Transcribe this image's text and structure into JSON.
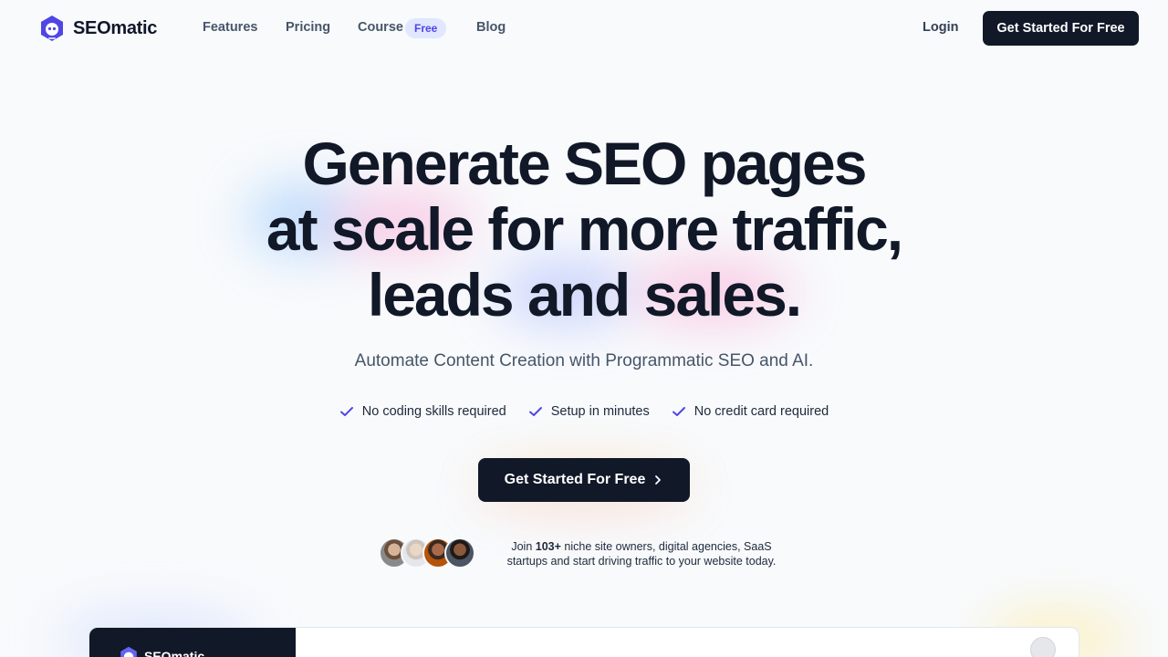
{
  "brand": {
    "name": "SEOmatic",
    "accent": "#4f46e5",
    "dark": "#111827"
  },
  "nav": {
    "features": "Features",
    "pricing": "Pricing",
    "course": "Course",
    "course_badge": "Free",
    "blog": "Blog",
    "login": "Login",
    "cta": "Get Started For Free"
  },
  "hero": {
    "line1": "Generate SEO pages",
    "line2": "at scale for more traffic,",
    "line3": "leads and sales.",
    "subtitle": "Automate Content Creation with Programmatic SEO and AI.",
    "checks": [
      "No coding skills required",
      "Setup in minutes",
      "No credit card required"
    ],
    "cta": "Get Started For Free",
    "social_pre": "Join ",
    "social_count": "103+",
    "social_post": " niche site owners, digital agencies, SaaS startups and start driving traffic to your website today."
  },
  "preview": {
    "logo_text": "SEOmatic"
  },
  "icons": {
    "logo": "robot-logo-icon",
    "check": "check-icon",
    "chevron": "chevron-right-icon"
  }
}
